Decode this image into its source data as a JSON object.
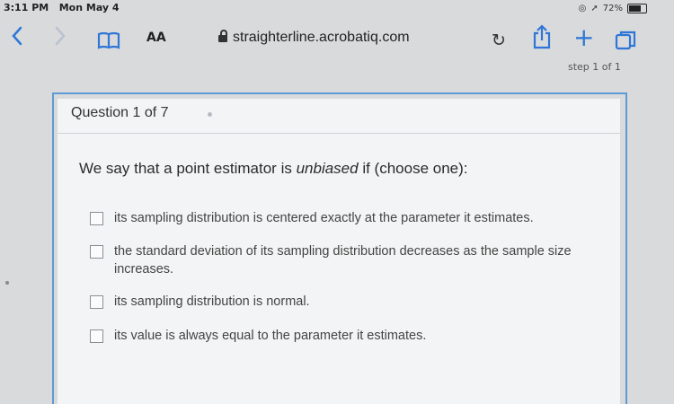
{
  "status_bar": {
    "time": "3:11 PM",
    "date": "Mon May 4",
    "battery": "72%",
    "battery_level": 0.72
  },
  "browser": {
    "text_size_label": "AA",
    "url": "straighterline.acrobatiq.com",
    "icons": [
      "back-icon",
      "forward-icon",
      "bookmarks-icon",
      "lock-icon",
      "reload-icon",
      "share-icon",
      "new-tab-icon",
      "tabs-icon"
    ]
  },
  "page": {
    "step_label": "step 1 of 1",
    "question_number": "Question 1 of 7",
    "stem_prefix": "We say that a point estimator is ",
    "stem_emphasis": "unbiased",
    "stem_suffix": " if (choose one):",
    "options": [
      {
        "label": "its sampling distribution is centered exactly at the parameter it estimates.",
        "checked": false
      },
      {
        "label": "the standard deviation of its sampling distribution decreases as the sample size increases.",
        "checked": false
      },
      {
        "label": "its sampling distribution is normal.",
        "checked": false
      },
      {
        "label": "its value is always equal to the parameter it estimates.",
        "checked": false
      }
    ]
  },
  "colors": {
    "accent": "#2f76d6",
    "card_border": "#5e9ad4"
  }
}
